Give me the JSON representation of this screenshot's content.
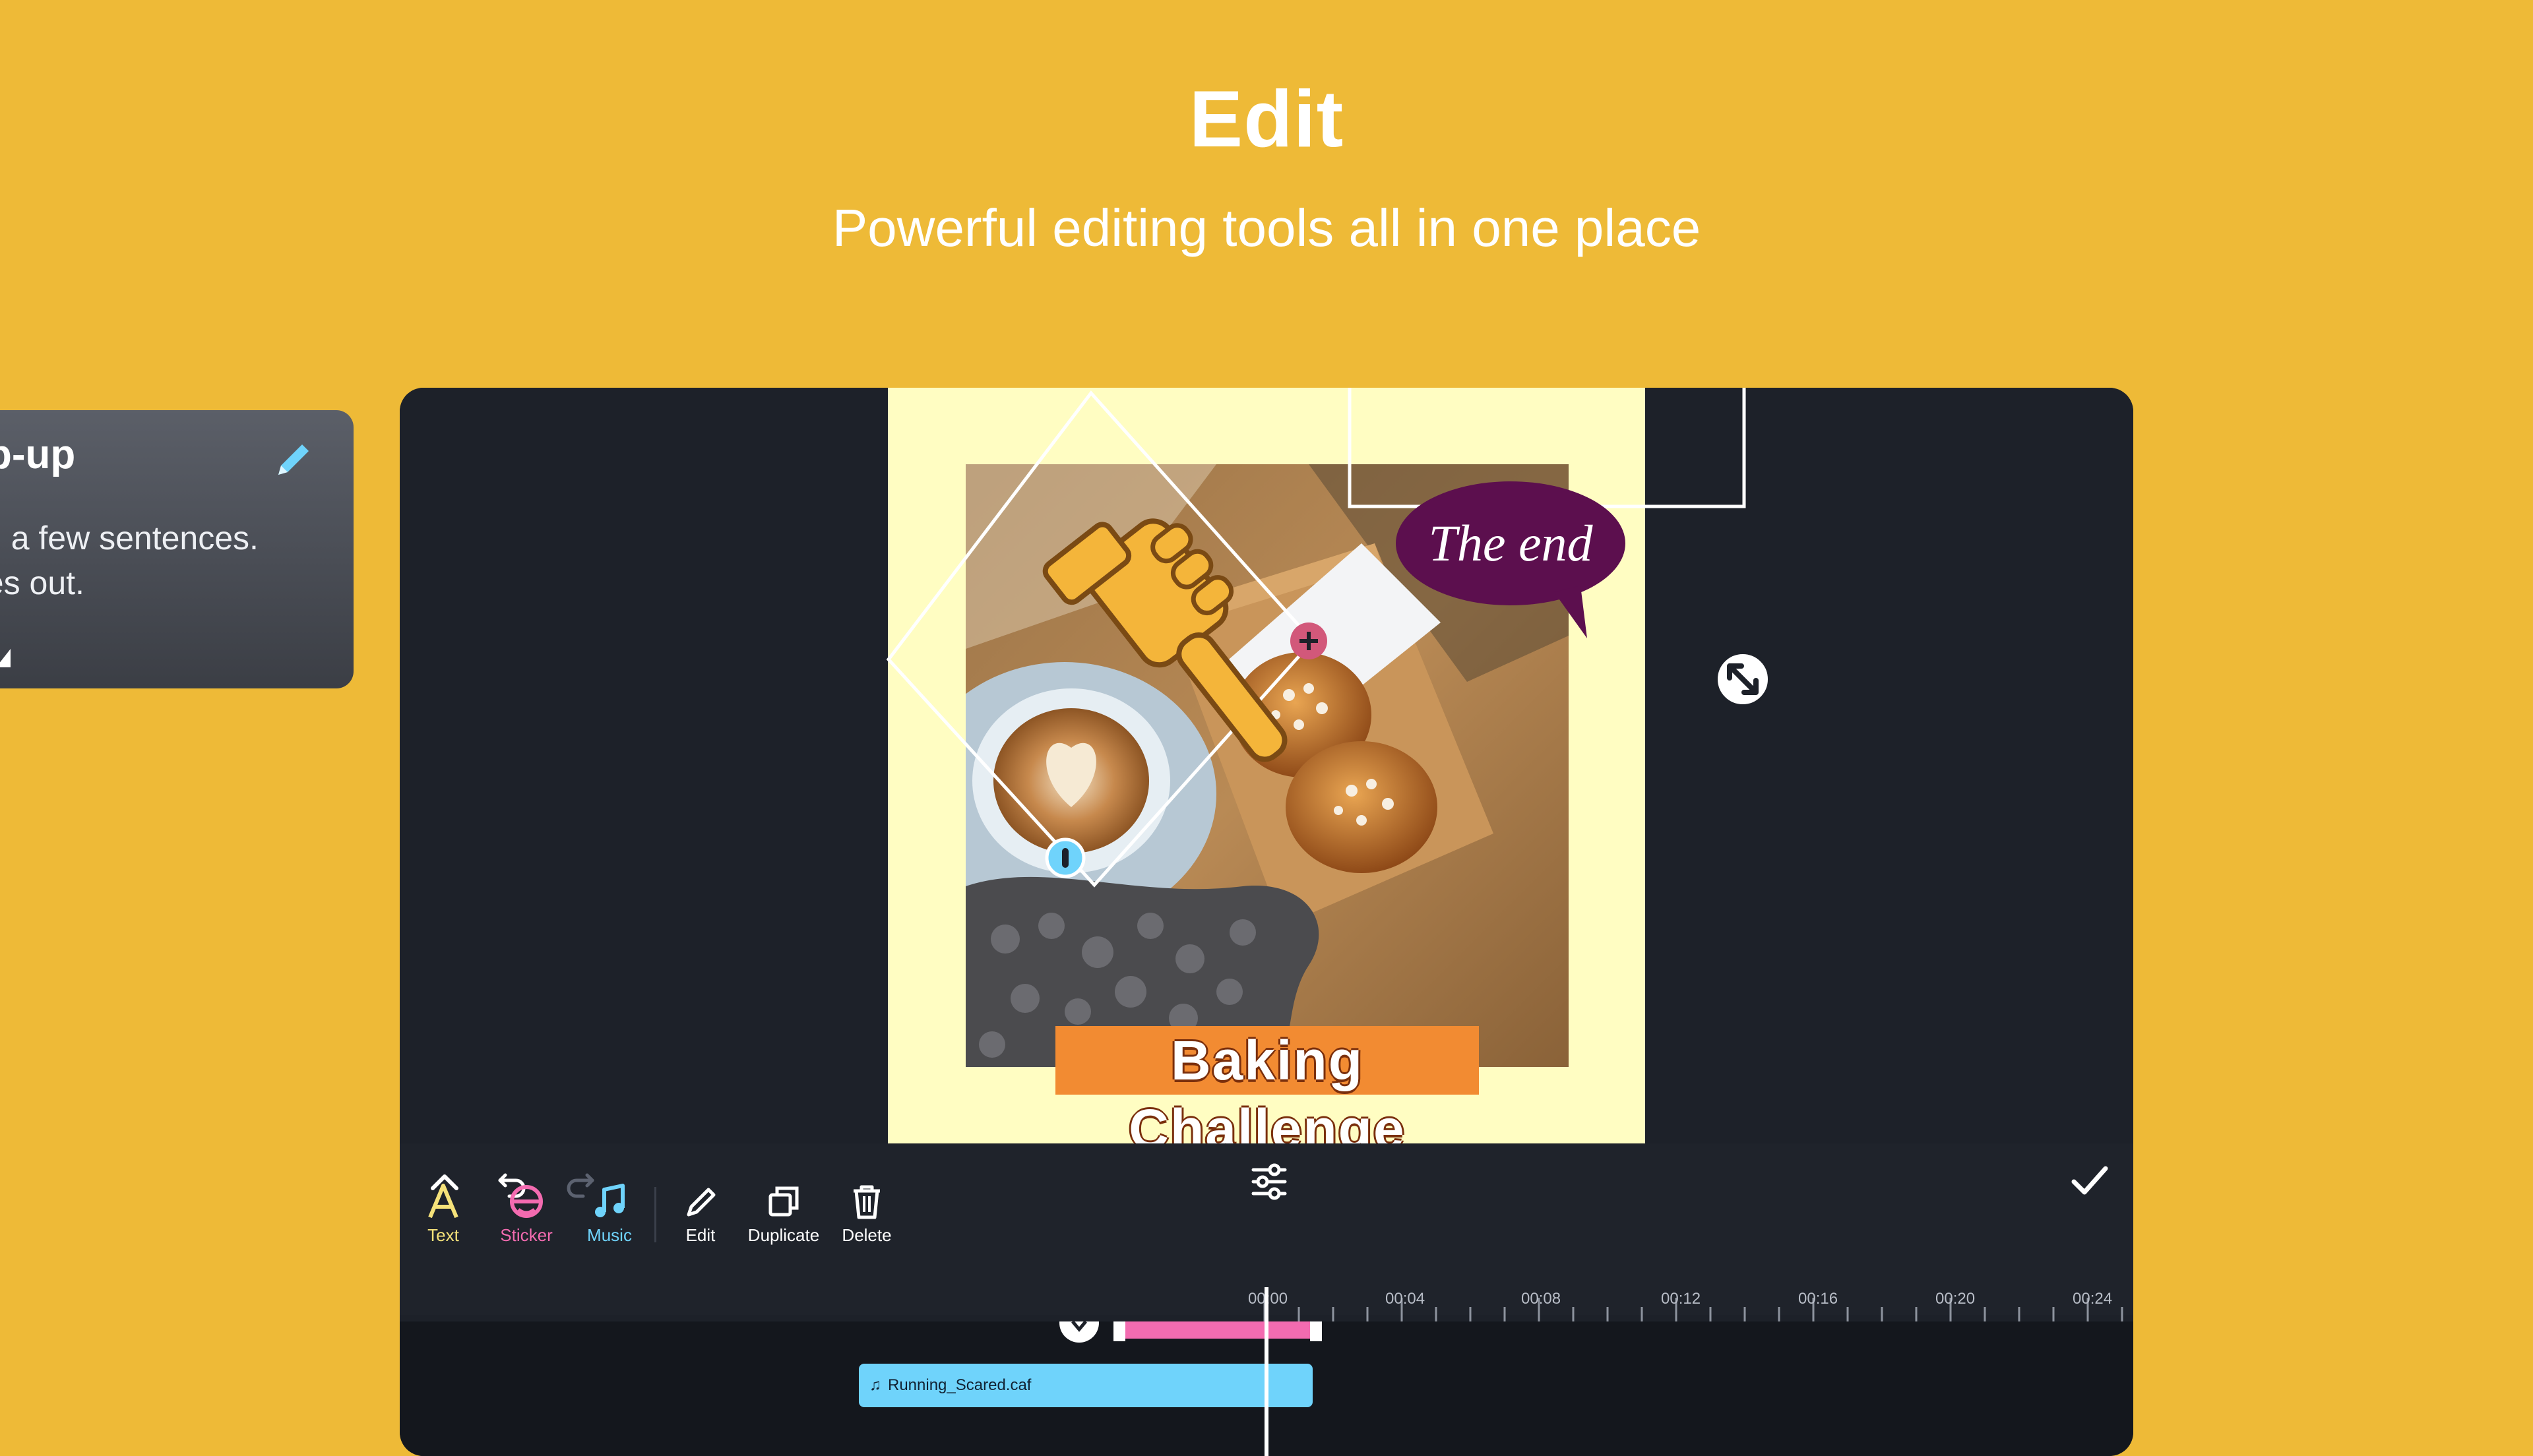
{
  "header": {
    "title": "Edit",
    "subtitle": "Powerful editing tools all in one place"
  },
  "popup": {
    "title": "p-up",
    "body": "ith a few sentences.\ndes out."
  },
  "canvas": {
    "speech_bubble_text": "The end",
    "caption_text": "Baking Challenge",
    "bubble_color": "#5C0F4E",
    "caption_color": "#F28B32",
    "handle_color": "#D2587A",
    "rotate_handle_color": "#6FD3FB"
  },
  "toolbar": {
    "tools": [
      {
        "label": "Text",
        "color": "#F5E27A"
      },
      {
        "label": "Sticker",
        "color": "#F36BB0"
      },
      {
        "label": "Music",
        "color": "#6FD3FB"
      },
      {
        "label": "Edit",
        "color": "#FFFFFF"
      },
      {
        "label": "Duplicate",
        "color": "#FFFFFF"
      },
      {
        "label": "Delete",
        "color": "#FFFFFF"
      }
    ]
  },
  "timeline": {
    "ticks": [
      "00:00",
      "00:04",
      "00:08",
      "00:12",
      "00:16",
      "00:20",
      "00:24"
    ],
    "music_clip_name": "Running_Scared.caf"
  }
}
